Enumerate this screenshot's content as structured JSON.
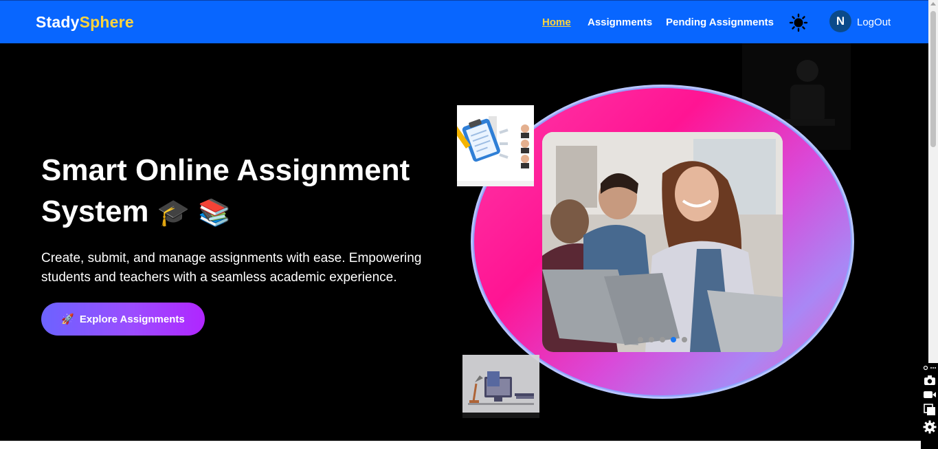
{
  "navbar": {
    "brand_part1": "Stady",
    "brand_part2": "Sphere",
    "links": [
      {
        "label": "Home",
        "active": true
      },
      {
        "label": "Assignments",
        "active": false
      },
      {
        "label": "Pending Assignments",
        "active": false
      }
    ],
    "theme_icon": "sun-icon",
    "avatar_initial": "N",
    "logout_label": "LogOut"
  },
  "hero": {
    "title_line1": "Smart Online Assignment",
    "title_line2": "System",
    "title_emoji1": "🎓",
    "title_emoji2": "📚",
    "subtitle": "Create, submit, and manage assignments with ease. Empowering students and teachers with a seamless academic experience.",
    "cta_icon": "🚀",
    "cta_label": "Explore Assignments",
    "carousel": {
      "slide_count": 5,
      "active_index": 3
    }
  },
  "colors": {
    "navbar_bg": "#0866ff",
    "brand_accent": "#ffd43b",
    "hero_bg": "#000000",
    "cta_gradient_start": "#6c63ff",
    "cta_gradient_end": "#b026ff",
    "blob_pink": "#ff1493"
  },
  "floating_toolbar": {
    "icons": [
      "link-icon",
      "more-icon",
      "camera-icon",
      "video-icon",
      "copy-icon",
      "gear-icon"
    ]
  }
}
